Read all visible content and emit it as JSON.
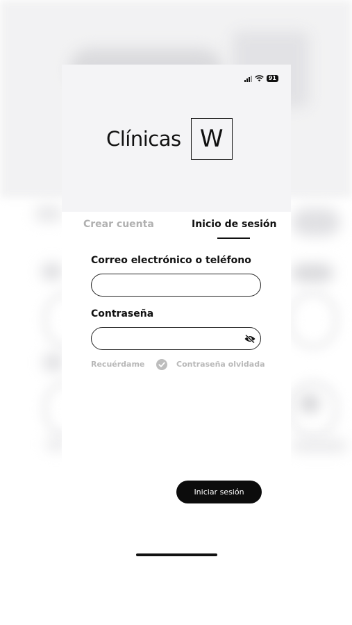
{
  "status": {
    "battery": "91",
    "signal_icon": "signal-icon",
    "wifi_icon": "wifi-icon"
  },
  "brand": {
    "name": "Clínicas",
    "mark": "W"
  },
  "tabs": [
    {
      "label": "Crear cuenta",
      "active": false
    },
    {
      "label": "Inicio de sesión",
      "active": true
    }
  ],
  "form": {
    "email_label": "Correo electrónico o teléfono",
    "email_value": "",
    "password_label": "Contraseña",
    "password_value": "",
    "remember_label": "Recuérdame",
    "forgot_label": "Contraseña olvidada",
    "submit_label": "Iniciar sesión"
  },
  "colors": {
    "primary": "#0c0c0c",
    "muted": "#b8b8b8",
    "header_bg": "#f4f4f6"
  }
}
